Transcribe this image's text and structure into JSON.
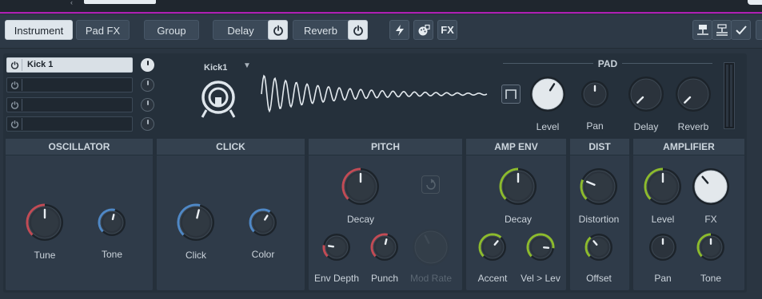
{
  "toolbar": {
    "tabs": [
      {
        "label": "Instrument",
        "active": true
      },
      {
        "label": "Pad FX",
        "active": false
      },
      {
        "label": "Group",
        "active": false
      }
    ],
    "delay_label": "Delay",
    "reverb_label": "Reverb",
    "fx_label": "FX",
    "icons": [
      "lightning-icon",
      "palette-icon",
      "fx-icon",
      "layout-top-icon",
      "layout-bottom-icon",
      "checkmark-icon"
    ]
  },
  "pads": [
    {
      "name": "Kick 1",
      "active": true
    },
    {
      "name": "",
      "active": false
    },
    {
      "name": "",
      "active": false
    },
    {
      "name": "",
      "active": false
    }
  ],
  "sample": {
    "name": "Kick1"
  },
  "pad_section": {
    "title": "PAD",
    "knobs": [
      {
        "label": "Level",
        "value": 0.62
      },
      {
        "label": "Pan",
        "value": 0.5
      },
      {
        "label": "Delay",
        "value": 0.0
      },
      {
        "label": "Reverb",
        "value": 0.0
      }
    ]
  },
  "sections": {
    "oscillator": {
      "title": "OSCILLATOR",
      "knobs": [
        {
          "label": "Tune",
          "value": 0.5
        },
        {
          "label": "Tone",
          "value": 0.55
        }
      ]
    },
    "click": {
      "title": "CLICK",
      "knobs": [
        {
          "label": "Click",
          "value": 0.55
        },
        {
          "label": "Color",
          "value": 0.62
        }
      ]
    },
    "pitch": {
      "title": "PITCH",
      "knobs": [
        {
          "label": "Decay",
          "value": 0.5
        },
        {
          "label": "Env Depth",
          "value": 0.2
        },
        {
          "label": "Punch",
          "value": 0.55
        },
        {
          "label": "Mod Rate",
          "value": 0.4
        }
      ]
    },
    "amp_env": {
      "title": "AMP ENV",
      "knobs": [
        {
          "label": "Decay",
          "value": 0.5
        },
        {
          "label": "Accent",
          "value": 0.65
        },
        {
          "label": "Vel > Lev",
          "value": 0.85
        }
      ]
    },
    "dist": {
      "title": "DIST",
      "knobs": [
        {
          "label": "Distortion",
          "value": 0.25
        },
        {
          "label": "Offset",
          "value": 0.35
        }
      ]
    },
    "amplifier": {
      "title": "AMPLIFIER",
      "knobs": [
        {
          "label": "Level",
          "value": 0.5
        },
        {
          "label": "FX",
          "value": 0.35
        },
        {
          "label": "Pan",
          "value": 0.5
        },
        {
          "label": "Tone",
          "value": 0.5
        }
      ]
    }
  },
  "colors": {
    "accent_top": "#b01fb4",
    "osc_ring": "#c24b55",
    "click_ring": "#4f88c6",
    "env_ring": "#8dbb2d",
    "knob_body_dark": "#2b333c",
    "knob_body_white": "#e3e8ec"
  }
}
